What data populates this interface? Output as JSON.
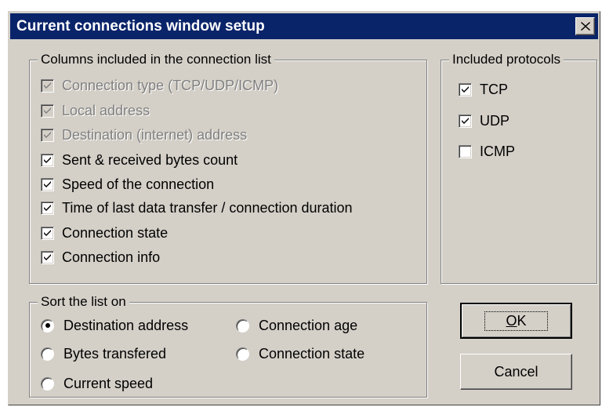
{
  "window": {
    "title": "Current connections window setup",
    "close_label": "close"
  },
  "columns_group": {
    "legend": "Columns included in the connection list",
    "items": [
      {
        "label": "Connection type (TCP/UDP/ICMP)",
        "checked": true,
        "enabled": false
      },
      {
        "label": "Local address",
        "checked": true,
        "enabled": false
      },
      {
        "label": "Destination (internet) address",
        "checked": true,
        "enabled": false
      },
      {
        "label": "Sent & received bytes count",
        "checked": true,
        "enabled": true
      },
      {
        "label": "Speed of the connection",
        "checked": true,
        "enabled": true
      },
      {
        "label": "Time of last data transfer / connection duration",
        "checked": true,
        "enabled": true
      },
      {
        "label": "Connection state",
        "checked": true,
        "enabled": true
      },
      {
        "label": "Connection info",
        "checked": true,
        "enabled": true
      }
    ]
  },
  "protocols_group": {
    "legend": "Included protocols",
    "items": [
      {
        "label": "TCP",
        "checked": true
      },
      {
        "label": "UDP",
        "checked": true
      },
      {
        "label": "ICMP",
        "checked": false
      }
    ]
  },
  "sort_group": {
    "legend": "Sort the list on",
    "options": [
      {
        "label": "Destination address",
        "selected": true
      },
      {
        "label": "Connection age",
        "selected": false
      },
      {
        "label": "Bytes transfered",
        "selected": false
      },
      {
        "label": "Connection state",
        "selected": false
      },
      {
        "label": "Current speed",
        "selected": false
      }
    ]
  },
  "buttons": {
    "ok_label": "OK",
    "ok_mnemonic": "O",
    "ok_rest": "K",
    "cancel_label": "Cancel"
  },
  "colors": {
    "titlebar": "#0a246a",
    "face": "#d4d0c8",
    "disabled_text": "#808080"
  }
}
